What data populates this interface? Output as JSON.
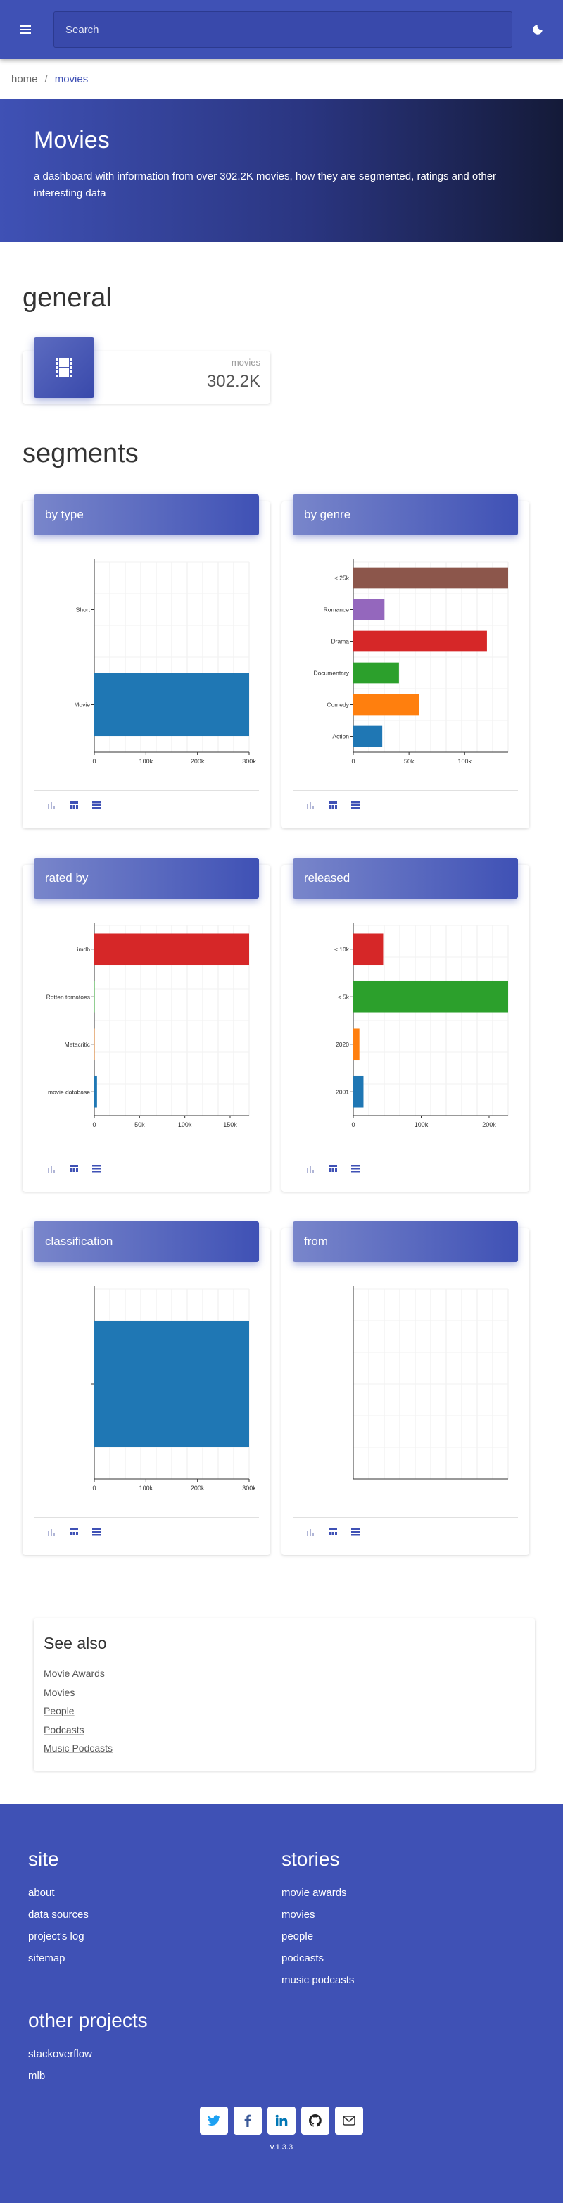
{
  "header": {
    "search_placeholder": "Search",
    "menu_icon": "hamburger-icon",
    "theme_icon": "moon-icon"
  },
  "breadcrumb": {
    "home": "home",
    "separator": "/",
    "current": "movies"
  },
  "hero": {
    "title": "Movies",
    "description": "a dashboard with information from over 302.2K movies, how they are segmented, ratings and other interesting data"
  },
  "general": {
    "title": "general",
    "stat": {
      "label": "movies",
      "value": "302.2K",
      "icon": "film-icon"
    }
  },
  "segments": {
    "title": "segments",
    "footer_icons": [
      "bar-chart-icon",
      "table-icon",
      "list-icon"
    ]
  },
  "colors": {
    "primary": "#3f51b5",
    "accent_light": "#7986cb"
  },
  "chart_data": [
    {
      "type": "bar",
      "title": "by type",
      "orientation": "horizontal",
      "categories": [
        "Short",
        "Movie"
      ],
      "values": [
        0,
        302200
      ],
      "colors": [
        "#1f77b4",
        "#1f77b4"
      ],
      "xlim": [
        0,
        300000
      ],
      "xticks": [
        "0",
        "100k",
        "200k",
        "300k"
      ]
    },
    {
      "type": "bar",
      "title": "by genre",
      "orientation": "horizontal",
      "categories": [
        "< 25k",
        "Romance",
        "Drama",
        "Documentary",
        "Comedy",
        "Action"
      ],
      "values": [
        139000,
        28000,
        120000,
        41000,
        59000,
        26000
      ],
      "colors": [
        "#8c564b",
        "#9467bd",
        "#d62728",
        "#2ca02c",
        "#ff7f0e",
        "#1f77b4"
      ],
      "xlim": [
        0,
        139000
      ],
      "xticks": [
        "0",
        "50k",
        "100k"
      ],
      "xtick_values": [
        0,
        50000,
        100000
      ]
    },
    {
      "type": "bar",
      "title": "rated by",
      "orientation": "horizontal",
      "categories": [
        "imdb",
        "Rotten tomatoes",
        "Metacritic",
        "movie database"
      ],
      "values": [
        171000,
        400,
        300,
        3000
      ],
      "colors": [
        "#d62728",
        "#2ca02c",
        "#ff7f0e",
        "#1f77b4"
      ],
      "xlim": [
        0,
        171000
      ],
      "xticks": [
        "0",
        "50k",
        "100k",
        "150k"
      ],
      "xtick_values": [
        0,
        50000,
        100000,
        150000
      ]
    },
    {
      "type": "bar",
      "title": "released",
      "orientation": "horizontal",
      "categories": [
        "< 10k",
        "< 5k",
        "2020",
        "2001"
      ],
      "values": [
        44000,
        228000,
        9000,
        15000
      ],
      "colors": [
        "#d62728",
        "#2ca02c",
        "#ff7f0e",
        "#1f77b4"
      ],
      "xlim": [
        0,
        228000
      ],
      "xticks": [
        "0",
        "100k",
        "200k"
      ],
      "xtick_values": [
        0,
        100000,
        200000
      ]
    },
    {
      "type": "bar",
      "title": "classification",
      "orientation": "horizontal",
      "categories": [
        ""
      ],
      "values": [
        302200
      ],
      "colors": [
        "#1f77b4"
      ],
      "xlim": [
        0,
        300000
      ],
      "xticks": [
        "0",
        "100k",
        "200k",
        "300k"
      ]
    },
    {
      "type": "bar",
      "title": "from",
      "orientation": "horizontal",
      "categories": [],
      "values": [],
      "colors": [],
      "xlim": [
        0,
        1
      ],
      "xticks": []
    }
  ],
  "see_also": {
    "title": "See also",
    "links": [
      "Movie Awards",
      "Movies",
      "People",
      "Podcasts",
      "Music Podcasts"
    ]
  },
  "footer": {
    "site": {
      "title": "site",
      "links": [
        "about",
        "data sources",
        "project's log",
        "sitemap"
      ]
    },
    "stories": {
      "title": "stories",
      "links": [
        "movie awards",
        "movies",
        "people",
        "podcasts",
        "music podcasts"
      ]
    },
    "other": {
      "title": "other projects",
      "links": [
        "stackoverflow",
        "mlb"
      ]
    },
    "socials": [
      "twitter-icon",
      "facebook-icon",
      "linkedin-icon",
      "github-icon",
      "mail-icon"
    ],
    "version": "v.1.3.3"
  }
}
